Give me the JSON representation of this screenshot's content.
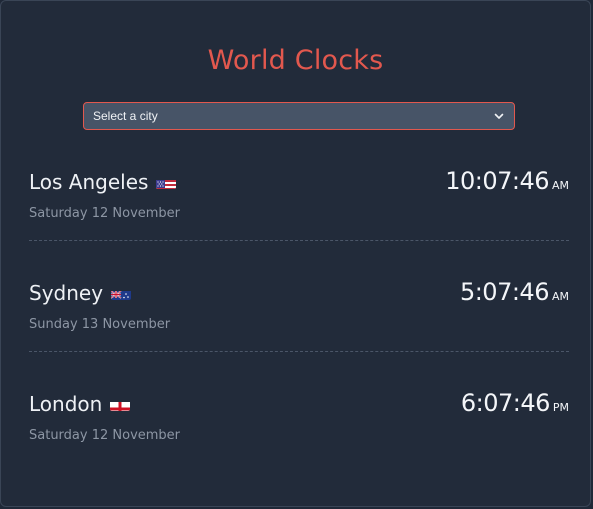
{
  "app": {
    "title": "World Clocks"
  },
  "city_select": {
    "selected": "Select a city"
  },
  "cities": [
    {
      "name": "Los Angeles",
      "flag": "us-flag-icon",
      "date": "Saturday 12 November",
      "time": "10:07:46",
      "period": "AM"
    },
    {
      "name": "Sydney",
      "flag": "au-flag-icon",
      "date": "Sunday 13 November",
      "time": "5:07:46",
      "period": "AM"
    },
    {
      "name": "London",
      "flag": "england-flag-icon",
      "date": "Saturday 12 November",
      "time": "6:07:46",
      "period": "PM"
    }
  ],
  "colors": {
    "accent": "#e2584e",
    "background": "#222b3a",
    "select_bg": "#475467",
    "muted_text": "#8d96a4"
  }
}
